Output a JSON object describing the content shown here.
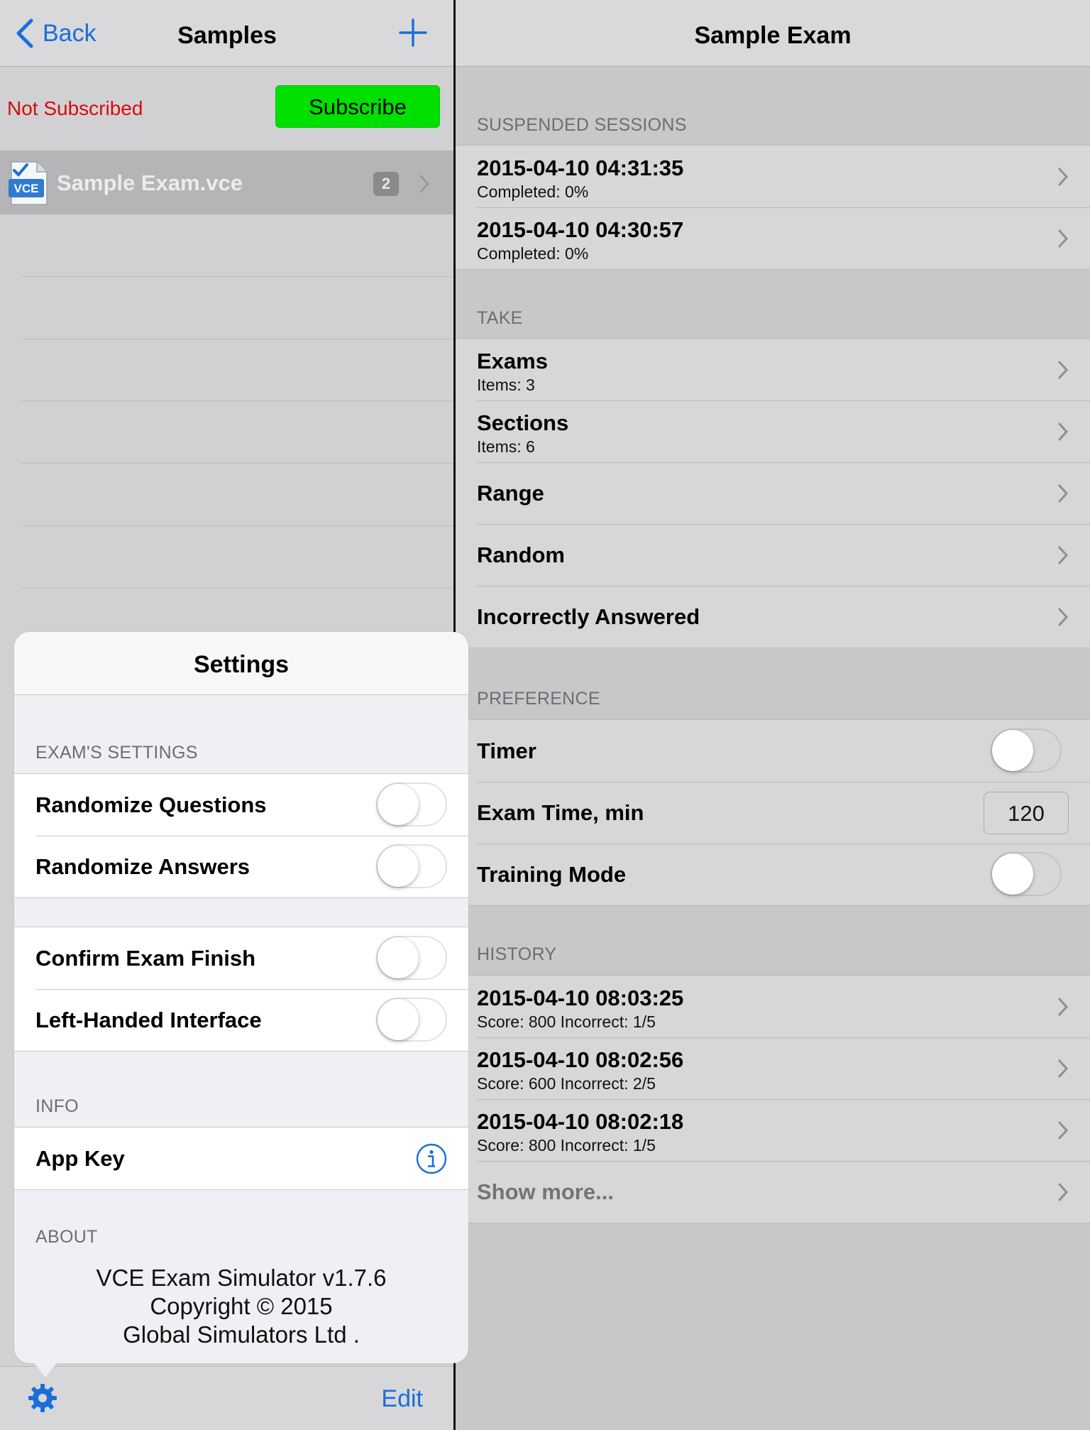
{
  "left": {
    "nav": {
      "back_label": "Back",
      "title": "Samples"
    },
    "subscription": {
      "status": "Not Subscribed",
      "button": "Subscribe"
    },
    "files": [
      {
        "name": "Sample Exam.vce",
        "badge": "2",
        "icon_text": "VCE"
      }
    ],
    "toolbar": {
      "edit_label": "Edit"
    }
  },
  "settings": {
    "title": "Settings",
    "sections": {
      "exam": "EXAM'S SETTINGS",
      "info": "INFO",
      "about": "ABOUT"
    },
    "exam_items": [
      {
        "label": "Randomize Questions",
        "on": false
      },
      {
        "label": "Randomize Answers",
        "on": false
      }
    ],
    "other_items": [
      {
        "label": "Confirm Exam Finish",
        "on": false
      },
      {
        "label": "Left-Handed Interface",
        "on": false
      }
    ],
    "info_items": [
      {
        "label": "App Key"
      }
    ],
    "about": {
      "line1": "VCE Exam Simulator v1.7.6",
      "line2": "Copyright © 2015",
      "line3": "Global Simulators Ltd ."
    }
  },
  "right": {
    "title": "Sample Exam",
    "suspended": {
      "header": "SUSPENDED SESSIONS",
      "items": [
        {
          "title": "2015-04-10 04:31:35",
          "sub": "Completed: 0%"
        },
        {
          "title": "2015-04-10 04:30:57",
          "sub": "Completed: 0%"
        }
      ]
    },
    "take": {
      "header": "TAKE",
      "items": [
        {
          "title": "Exams",
          "sub": "Items: 3"
        },
        {
          "title": "Sections",
          "sub": "Items: 6"
        },
        {
          "title": "Range"
        },
        {
          "title": "Random"
        },
        {
          "title": "Incorrectly Answered"
        }
      ]
    },
    "preference": {
      "header": "PREFERENCE",
      "timer_label": "Timer",
      "timer_on": false,
      "exam_time_label": "Exam Time, min",
      "exam_time_value": "120",
      "training_label": "Training Mode",
      "training_on": false
    },
    "history": {
      "header": "HISTORY",
      "items": [
        {
          "title": "2015-04-10 08:03:25",
          "sub": "Score: 800 Incorrect: 1/5"
        },
        {
          "title": "2015-04-10 08:02:56",
          "sub": "Score: 600 Incorrect: 2/5"
        },
        {
          "title": "2015-04-10 08:02:18",
          "sub": "Score: 800 Incorrect: 1/5"
        }
      ],
      "show_more": "Show more..."
    }
  },
  "colors": {
    "accent_blue": "#1a6ed8",
    "not_subscribed_red": "#d60c0c",
    "subscribe_green": "#00e000"
  },
  "icons": [
    "back-chevron-icon",
    "plus-icon",
    "vce-file-icon",
    "chevron-right-icon",
    "gear-icon",
    "info-icon"
  ]
}
